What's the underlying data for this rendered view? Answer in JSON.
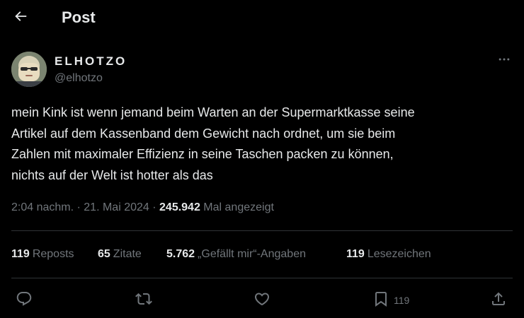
{
  "header": {
    "title": "Post",
    "back_icon": "arrow-left-icon"
  },
  "author": {
    "display_name": "ELHOTZO",
    "handle": "@elhotzo",
    "more_icon": "ellipsis-icon"
  },
  "tweet": {
    "lines": [
      "mein Kink ist wenn jemand beim Warten an der Supermarktkasse seine",
      "Artikel auf dem Kassenband dem Gewicht nach ordnet, um sie beim",
      "Zahlen mit maximaler Effizienz in seine Taschen packen zu können,",
      "nichts auf der Welt ist hotter als das"
    ]
  },
  "meta": {
    "time": "2:04 nachm.",
    "sep1": " · ",
    "date": "21. Mai 2024",
    "sep2": " · ",
    "views": "245.942",
    "views_label": " Mal angezeigt"
  },
  "stats": {
    "reposts": {
      "count": "119",
      "label": "Reposts"
    },
    "quotes": {
      "count": "65",
      "label": "Zitate"
    },
    "likes": {
      "count": "5.762",
      "label": "„Gefällt mir“-Angaben"
    },
    "bookmarks": {
      "count": "119",
      "label": "Lesezeichen"
    }
  },
  "actions": {
    "reply_icon": "reply-icon",
    "repost_icon": "repost-icon",
    "like_icon": "heart-icon",
    "bookmark_icon": "bookmark-icon",
    "bookmark_count": "119",
    "share_icon": "share-icon"
  },
  "colors": {
    "background": "#000000",
    "text": "#e7e9ea",
    "muted": "#71767b",
    "divider": "#2f3336"
  }
}
